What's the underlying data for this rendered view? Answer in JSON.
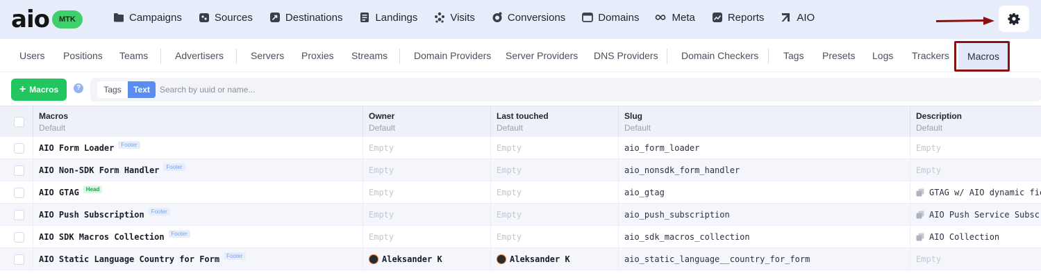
{
  "logo": {
    "wordmark": "aio",
    "badge": "MTK"
  },
  "topnav": [
    {
      "label": "Campaigns",
      "icon": "folder-icon"
    },
    {
      "label": "Sources",
      "icon": "puzzle-icon"
    },
    {
      "label": "Destinations",
      "icon": "share-icon"
    },
    {
      "label": "Landings",
      "icon": "page-icon"
    },
    {
      "label": "Visits",
      "icon": "users-icon"
    },
    {
      "label": "Conversions",
      "icon": "coins-icon"
    },
    {
      "label": "Domains",
      "icon": "window-icon"
    },
    {
      "label": "Meta",
      "icon": "infinity-icon"
    },
    {
      "label": "Reports",
      "icon": "chart-icon"
    },
    {
      "label": "AIO",
      "icon": "aio-icon"
    }
  ],
  "subnav": {
    "items": [
      "Users",
      "Positions",
      "Teams",
      "Advertisers",
      "Servers",
      "Proxies",
      "Streams",
      "Domain Providers",
      "Server Providers",
      "DNS Providers",
      "Domain Checkers",
      "Tags",
      "Presets",
      "Logs",
      "Trackers"
    ],
    "active": "Macros"
  },
  "toolbar": {
    "add_label": "Macros",
    "help_glyph": "?",
    "tags_label": "Tags",
    "text_label": "Text",
    "search_placeholder": "Search by uuid or name..."
  },
  "table": {
    "columns": [
      {
        "title": "Macros",
        "sub": "Default"
      },
      {
        "title": "Owner",
        "sub": "Default"
      },
      {
        "title": "Last touched",
        "sub": "Default"
      },
      {
        "title": "Slug",
        "sub": "Default"
      },
      {
        "title": "Description",
        "sub": "Default"
      }
    ],
    "rows": [
      {
        "name": "AIO Form Loader",
        "badge": "Footer",
        "owner": "Empty",
        "touched": "Empty",
        "slug": "aio_form_loader",
        "description": "Empty"
      },
      {
        "name": "AIO Non-SDK Form Handler",
        "badge": "Footer",
        "owner": "Empty",
        "touched": "Empty",
        "slug": "aio_nonsdk_form_handler",
        "description": "Empty"
      },
      {
        "name": "AIO GTAG",
        "badge": "Head",
        "owner": "Empty",
        "touched": "Empty",
        "slug": "aio_gtag",
        "description": "GTAG w/ AIO dynamic fie"
      },
      {
        "name": "AIO Push Subscription",
        "badge": "Footer",
        "owner": "Empty",
        "touched": "Empty",
        "slug": "aio_push_subscription",
        "description": "AIO Push Service Subscr"
      },
      {
        "name": "AIO SDK Macros Collection",
        "badge": "Footer",
        "owner": "Empty",
        "touched": "Empty",
        "slug": "aio_sdk_macros_collection",
        "description": "AIO Collection"
      },
      {
        "name": "AIO Static Language Country for Form",
        "badge": "Footer",
        "owner": "Aleksander K",
        "touched": "Aleksander K",
        "slug": "aio_static_language__country_for_form",
        "description": "Empty"
      }
    ]
  },
  "colors": {
    "topbar_bg": "#e8edfb",
    "accent_green": "#22c55e",
    "accent_blue": "#5b8df0",
    "highlight_box": "#8b1111"
  }
}
